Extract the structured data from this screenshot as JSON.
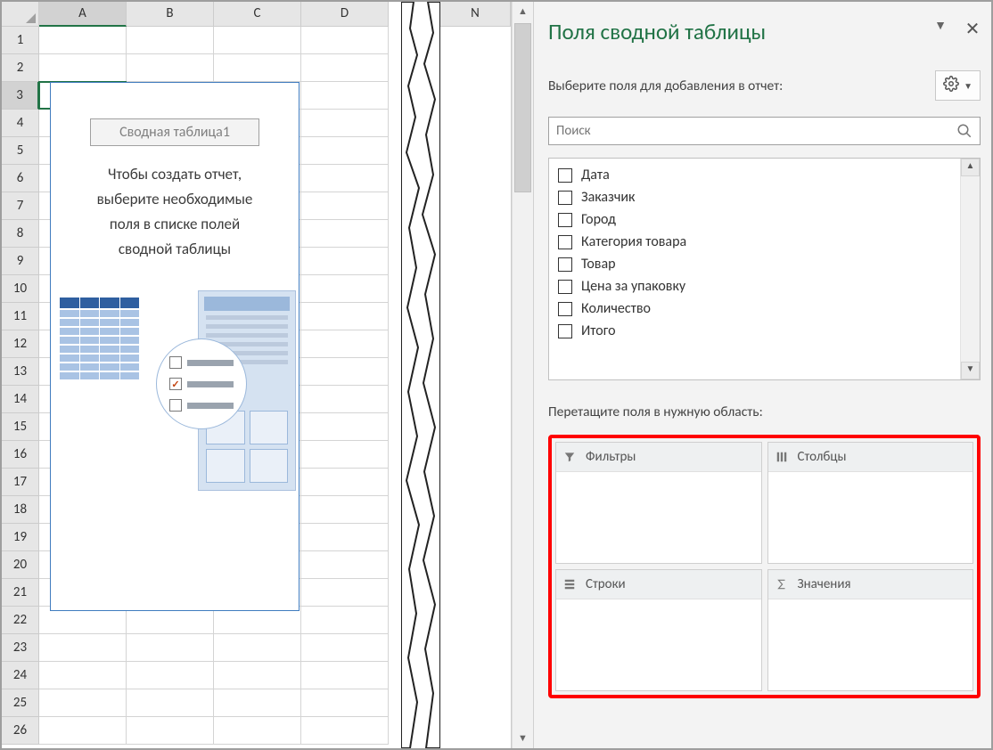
{
  "grid": {
    "columns": [
      "A",
      "B",
      "C",
      "D"
    ],
    "column_n": "N",
    "rows": [
      "1",
      "2",
      "3",
      "4",
      "5",
      "6",
      "7",
      "8",
      "9",
      "10",
      "11",
      "12",
      "13",
      "14",
      "15",
      "16",
      "17",
      "18",
      "19",
      "20",
      "21",
      "22",
      "23",
      "24",
      "25",
      "26"
    ],
    "selected_column": "A",
    "selected_row": "3",
    "active_cell": "A3"
  },
  "pivot_placeholder": {
    "name": "Сводная таблица1",
    "message_l1": "Чтобы создать отчет,",
    "message_l2": "выберите необходимые",
    "message_l3": "поля в списке полей",
    "message_l4": "сводной таблицы"
  },
  "pane": {
    "title": "Поля сводной таблицы",
    "subtitle": "Выберите поля для добавления в отчет:",
    "search_placeholder": "Поиск",
    "fields": [
      {
        "label": "Дата",
        "checked": false
      },
      {
        "label": "Заказчик",
        "checked": false
      },
      {
        "label": "Город",
        "checked": false
      },
      {
        "label": "Категория товара",
        "checked": false
      },
      {
        "label": "Товар",
        "checked": false
      },
      {
        "label": "Цена за упаковку",
        "checked": false
      },
      {
        "label": "Количество",
        "checked": false
      },
      {
        "label": "Итого",
        "checked": false
      }
    ],
    "drag_label": "Перетащите поля в нужную область:",
    "areas": {
      "filters": "Фильтры",
      "columns": "Столбцы",
      "rows": "Строки",
      "values": "Значения"
    }
  }
}
